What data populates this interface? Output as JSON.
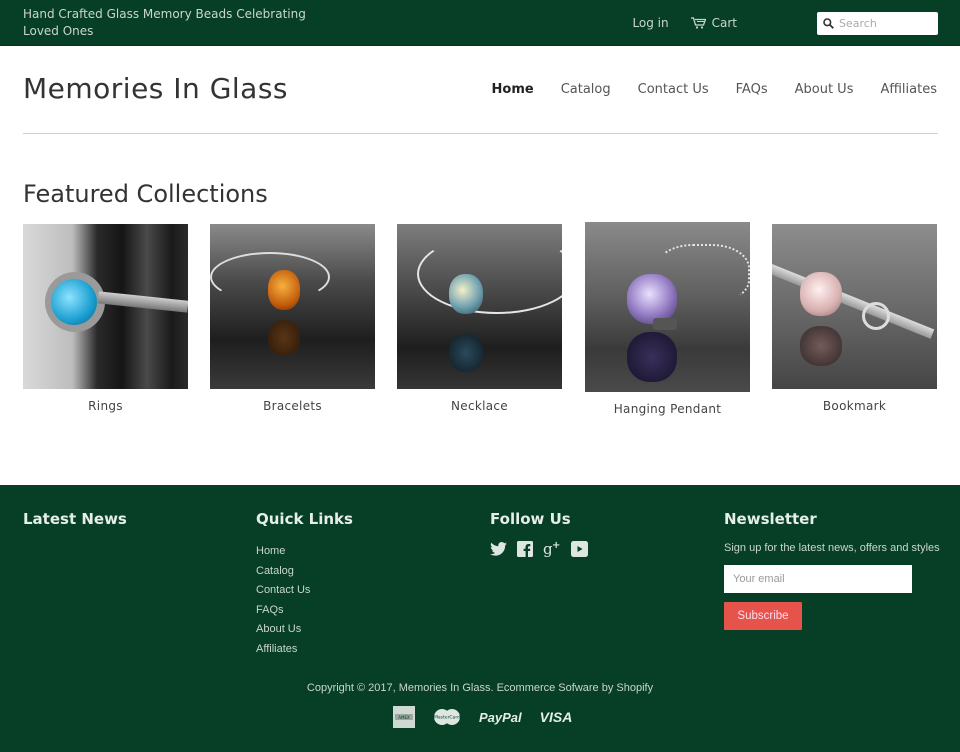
{
  "topbar": {
    "tagline": "Hand Crafted Glass Memory Beads Celebrating Loved Ones",
    "login_label": "Log in",
    "cart_label": "Cart",
    "search_placeholder": "Search"
  },
  "header": {
    "logo": "Memories In Glass",
    "nav": [
      {
        "label": "Home",
        "active": true
      },
      {
        "label": "Catalog"
      },
      {
        "label": "Contact Us"
      },
      {
        "label": "FAQs"
      },
      {
        "label": "About Us"
      },
      {
        "label": "Affiliates"
      }
    ]
  },
  "featured": {
    "title": "Featured Collections",
    "collections": [
      {
        "label": "Rings",
        "image": "blue-glass-ring"
      },
      {
        "label": "Bracelets",
        "image": "amber-bead-bracelet"
      },
      {
        "label": "Necklace",
        "image": "clear-bead-necklace"
      },
      {
        "label": "Hanging Pendant",
        "image": "purple-bead-pendant"
      },
      {
        "label": "Bookmark",
        "image": "pink-bead-bookmark"
      }
    ]
  },
  "footer": {
    "latest_news_title": "Latest News",
    "quick_links_title": "Quick Links",
    "quick_links": [
      "Home",
      "Catalog",
      "Contact Us",
      "FAQs",
      "About Us",
      "Affiliates"
    ],
    "follow_title": "Follow Us",
    "social": [
      "twitter-icon",
      "facebook-icon",
      "google-plus-icon",
      "youtube-icon"
    ],
    "newsletter_title": "Newsletter",
    "newsletter_text": "Sign up for the latest news, offers and styles",
    "email_placeholder": "Your email",
    "subscribe_label": "Subscribe",
    "copyright": "Copyright © 2017, Memories In Glass. Ecommerce Sofware by Shopify",
    "payments": {
      "amex": "American Express",
      "mastercard": "MasterCard",
      "paypal": "PayPal",
      "visa": "VISA"
    }
  },
  "colors": {
    "brand_green": "#063e26",
    "subscribe_red": "#e5534b"
  }
}
